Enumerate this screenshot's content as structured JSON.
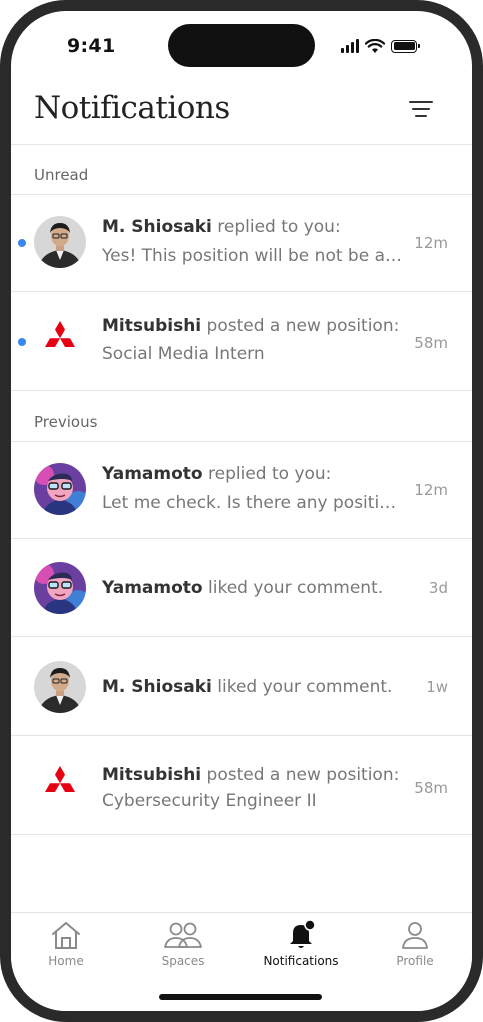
{
  "status_bar": {
    "time": "9:41"
  },
  "header": {
    "title": "Notifications"
  },
  "sections": {
    "unread": {
      "label": "Unread",
      "items": [
        {
          "sender": "M. Shiosaki",
          "action": " replied to you:",
          "preview": "Yes! This position will be not be av…",
          "time": "12m",
          "avatar": "person-avatar",
          "unread": true
        },
        {
          "sender": "Mitsubishi",
          "action": " posted a new position:",
          "preview": "Social Media Intern",
          "time": "58m",
          "avatar": "mitsubishi-logo",
          "unread": true
        }
      ]
    },
    "previous": {
      "label": "Previous",
      "items": [
        {
          "sender": "Yamamoto",
          "action": " replied to you:",
          "preview": "Let me check. Is there any positio…",
          "time": "12m",
          "avatar": "cartoon-avatar"
        },
        {
          "sender": "Yamamoto",
          "action": " liked your comment.",
          "preview": "",
          "time": "3d",
          "avatar": "cartoon-avatar"
        },
        {
          "sender": "M. Shiosaki",
          "action": " liked your comment.",
          "preview": "",
          "time": "1w",
          "avatar": "person-avatar"
        },
        {
          "sender": "Mitsubishi",
          "action": " posted a new position:",
          "preview": "Cybersecurity Engineer II",
          "time": "58m",
          "avatar": "mitsubishi-logo"
        }
      ]
    }
  },
  "tabbar": {
    "items": [
      {
        "label": "Home",
        "icon": "home-icon"
      },
      {
        "label": "Spaces",
        "icon": "people-icon"
      },
      {
        "label": "Notifications",
        "icon": "bell-icon",
        "active": true
      },
      {
        "label": "Profile",
        "icon": "profile-icon"
      }
    ]
  },
  "colors": {
    "unread_dot": "#3b86f0",
    "brand_red": "#e60012"
  }
}
